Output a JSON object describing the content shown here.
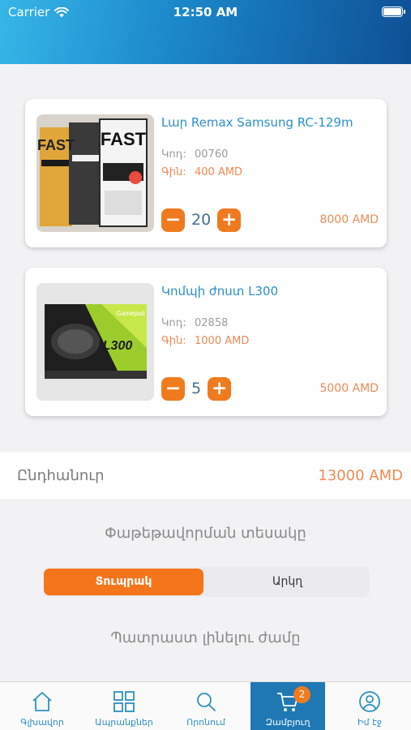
{
  "status_bar": {
    "carrier": "Carrier",
    "time": "12:50 AM"
  },
  "cart": {
    "items": [
      {
        "name": "Լար Remax Samsung RC-129m",
        "code_label": "Կոդ:",
        "code": "00760",
        "price_label": "Գին:",
        "price": "400 AMD",
        "qty": "20",
        "line_total": "8000 AMD",
        "thumb_texts": [
          "FAST",
          "FAST"
        ]
      },
      {
        "name": "Կոմպի ժոստ L300",
        "code_label": "Կոդ:",
        "code": "02858",
        "price_label": "Գին:",
        "price": "1000 AMD",
        "qty": "5",
        "line_total": "5000 AMD",
        "thumb_texts": [
          "Gamepad",
          "L300"
        ]
      }
    ],
    "total_label": "Ընդհանուր",
    "total_value": "13000 AMD"
  },
  "delivery": {
    "title": "Փաթեթավորման տեսակը",
    "options": [
      "Տուպրակ",
      "Արկղ"
    ],
    "selected": "Տուպրակ",
    "ready_title": "Պատրաստ լինելու ժամը"
  },
  "tabs": [
    {
      "label": "Գլխավոր",
      "icon": "home-icon"
    },
    {
      "label": "Ապրանքներ",
      "icon": "grid-icon"
    },
    {
      "label": "Որոնում",
      "icon": "search-icon"
    },
    {
      "label": "Զամբյուղ",
      "icon": "cart-icon",
      "badge": "2",
      "active": true
    },
    {
      "label": "Իմ էջ",
      "icon": "profile-icon"
    }
  ],
  "colors": {
    "accent": "#f07b1f",
    "primary": "#2d8fc4",
    "header_start": "#36b6e8",
    "header_end": "#0f4f94"
  }
}
